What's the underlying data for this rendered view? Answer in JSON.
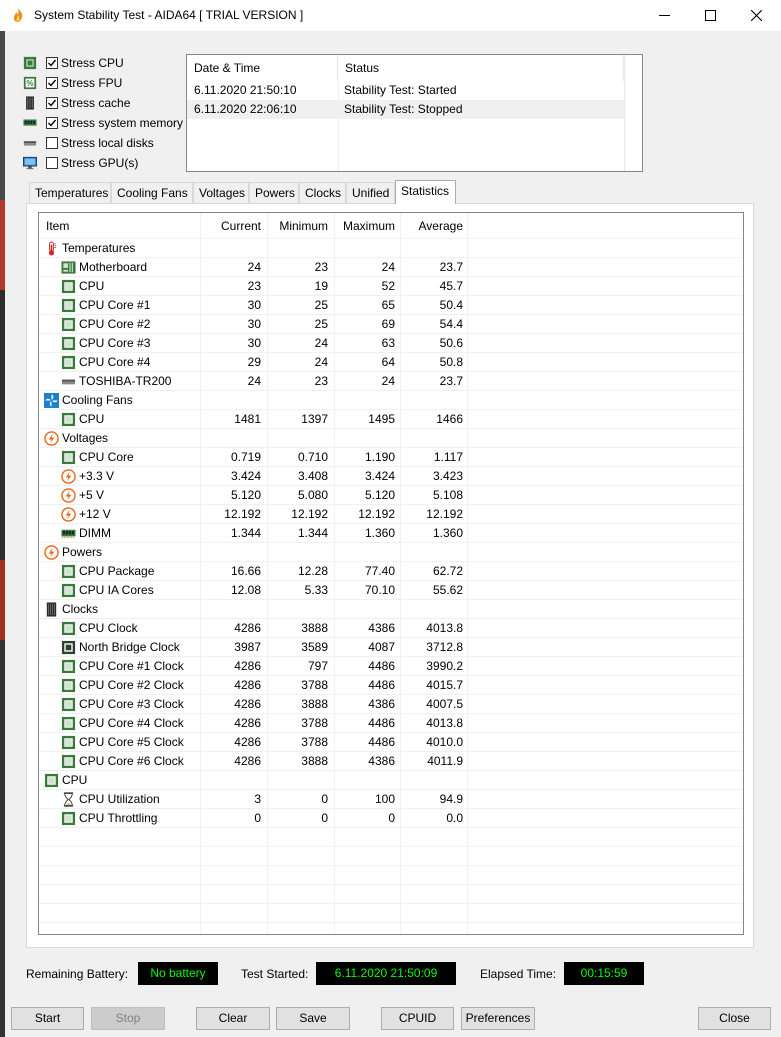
{
  "window": {
    "title": "System Stability Test - AIDA64  [ TRIAL VERSION ]"
  },
  "stress": [
    {
      "label": "Stress CPU",
      "checked": true,
      "icon": "cpu-icon"
    },
    {
      "label": "Stress FPU",
      "checked": true,
      "icon": "fpu-icon"
    },
    {
      "label": "Stress cache",
      "checked": true,
      "icon": "cache-icon"
    },
    {
      "label": "Stress system memory",
      "checked": true,
      "icon": "memory-icon"
    },
    {
      "label": "Stress local disks",
      "checked": false,
      "icon": "disk-icon"
    },
    {
      "label": "Stress GPU(s)",
      "checked": false,
      "icon": "gpu-icon"
    }
  ],
  "log": {
    "headers": {
      "datetime": "Date & Time",
      "status": "Status"
    },
    "rows": [
      {
        "datetime": "6.11.2020 21:50:10",
        "status": "Stability Test: Started"
      },
      {
        "datetime": "6.11.2020 22:06:10",
        "status": "Stability Test: Stopped"
      }
    ]
  },
  "tabs": [
    "Temperatures",
    "Cooling Fans",
    "Voltages",
    "Powers",
    "Clocks",
    "Unified",
    "Statistics"
  ],
  "active_tab": "Statistics",
  "stats": {
    "headers": {
      "item": "Item",
      "current": "Current",
      "minimum": "Minimum",
      "maximum": "Maximum",
      "average": "Average"
    },
    "rows": [
      {
        "type": "group",
        "label": "Temperatures",
        "icon": "thermometer-icon"
      },
      {
        "type": "item",
        "label": "Motherboard",
        "icon": "motherboard-icon",
        "cur": "24",
        "min": "23",
        "max": "24",
        "avg": "23.7"
      },
      {
        "type": "item",
        "label": "CPU",
        "icon": "chip-icon",
        "cur": "23",
        "min": "19",
        "max": "52",
        "avg": "45.7"
      },
      {
        "type": "item",
        "label": "CPU Core #1",
        "icon": "chip-icon",
        "cur": "30",
        "min": "25",
        "max": "65",
        "avg": "50.4"
      },
      {
        "type": "item",
        "label": "CPU Core #2",
        "icon": "chip-icon",
        "cur": "30",
        "min": "25",
        "max": "69",
        "avg": "54.4"
      },
      {
        "type": "item",
        "label": "CPU Core #3",
        "icon": "chip-icon",
        "cur": "30",
        "min": "24",
        "max": "63",
        "avg": "50.6"
      },
      {
        "type": "item",
        "label": "CPU Core #4",
        "icon": "chip-icon",
        "cur": "29",
        "min": "24",
        "max": "64",
        "avg": "50.8"
      },
      {
        "type": "item",
        "label": "TOSHIBA-TR200",
        "icon": "drive-icon",
        "cur": "24",
        "min": "23",
        "max": "24",
        "avg": "23.7"
      },
      {
        "type": "group",
        "label": "Cooling Fans",
        "icon": "fan-icon"
      },
      {
        "type": "item",
        "label": "CPU",
        "icon": "chip-icon",
        "cur": "1481",
        "min": "1397",
        "max": "1495",
        "avg": "1466"
      },
      {
        "type": "group",
        "label": "Voltages",
        "icon": "bolt-icon"
      },
      {
        "type": "item",
        "label": "CPU Core",
        "icon": "chip-icon",
        "cur": "0.719",
        "min": "0.710",
        "max": "1.190",
        "avg": "1.117"
      },
      {
        "type": "item",
        "label": "+3.3 V",
        "icon": "bolt-icon",
        "cur": "3.424",
        "min": "3.408",
        "max": "3.424",
        "avg": "3.423"
      },
      {
        "type": "item",
        "label": "+5 V",
        "icon": "bolt-icon",
        "cur": "5.120",
        "min": "5.080",
        "max": "5.120",
        "avg": "5.108"
      },
      {
        "type": "item",
        "label": "+12 V",
        "icon": "bolt-icon",
        "cur": "12.192",
        "min": "12.192",
        "max": "12.192",
        "avg": "12.192"
      },
      {
        "type": "item",
        "label": "DIMM",
        "icon": "ram-icon",
        "cur": "1.344",
        "min": "1.344",
        "max": "1.360",
        "avg": "1.360"
      },
      {
        "type": "group",
        "label": "Powers",
        "icon": "bolt-icon"
      },
      {
        "type": "item",
        "label": "CPU Package",
        "icon": "chip-icon",
        "cur": "16.66",
        "min": "12.28",
        "max": "77.40",
        "avg": "62.72"
      },
      {
        "type": "item",
        "label": "CPU IA Cores",
        "icon": "chip-icon",
        "cur": "12.08",
        "min": "5.33",
        "max": "70.10",
        "avg": "55.62"
      },
      {
        "type": "group",
        "label": "Clocks",
        "icon": "clock-module-icon"
      },
      {
        "type": "item",
        "label": "CPU Clock",
        "icon": "chip-icon",
        "cur": "4286",
        "min": "3888",
        "max": "4386",
        "avg": "4013.8"
      },
      {
        "type": "item",
        "label": "North Bridge Clock",
        "icon": "chip-dark-icon",
        "cur": "3987",
        "min": "3589",
        "max": "4087",
        "avg": "3712.8"
      },
      {
        "type": "item",
        "label": "CPU Core #1 Clock",
        "icon": "chip-icon",
        "cur": "4286",
        "min": "797",
        "max": "4486",
        "avg": "3990.2"
      },
      {
        "type": "item",
        "label": "CPU Core #2 Clock",
        "icon": "chip-icon",
        "cur": "4286",
        "min": "3788",
        "max": "4486",
        "avg": "4015.7"
      },
      {
        "type": "item",
        "label": "CPU Core #3 Clock",
        "icon": "chip-icon",
        "cur": "4286",
        "min": "3888",
        "max": "4386",
        "avg": "4007.5"
      },
      {
        "type": "item",
        "label": "CPU Core #4 Clock",
        "icon": "chip-icon",
        "cur": "4286",
        "min": "3788",
        "max": "4486",
        "avg": "4013.8"
      },
      {
        "type": "item",
        "label": "CPU Core #5 Clock",
        "icon": "chip-icon",
        "cur": "4286",
        "min": "3788",
        "max": "4486",
        "avg": "4010.0"
      },
      {
        "type": "item",
        "label": "CPU Core #6 Clock",
        "icon": "chip-icon",
        "cur": "4286",
        "min": "3888",
        "max": "4386",
        "avg": "4011.9"
      },
      {
        "type": "group",
        "label": "CPU",
        "icon": "chip-icon"
      },
      {
        "type": "item",
        "label": "CPU Utilization",
        "icon": "hourglass-icon",
        "cur": "3",
        "min": "0",
        "max": "100",
        "avg": "94.9"
      },
      {
        "type": "item",
        "label": "CPU Throttling",
        "icon": "chip-icon",
        "cur": "0",
        "min": "0",
        "max": "0",
        "avg": "0.0"
      }
    ]
  },
  "status": {
    "battery_label": "Remaining Battery:",
    "battery_value": "No battery",
    "started_label": "Test Started:",
    "started_value": "6.11.2020 21:50:09",
    "elapsed_label": "Elapsed Time:",
    "elapsed_value": "00:15:59"
  },
  "buttons": {
    "start": "Start",
    "stop": "Stop",
    "clear": "Clear",
    "save": "Save",
    "cpuid": "CPUID",
    "preferences": "Preferences",
    "close": "Close"
  },
  "colors": {
    "status_bg": "#000000",
    "status_text": "#00ff00",
    "chip_green": "#3a7a3a",
    "bolt_orange": "#e8661a",
    "fan_blue": "#1c7fd0"
  }
}
